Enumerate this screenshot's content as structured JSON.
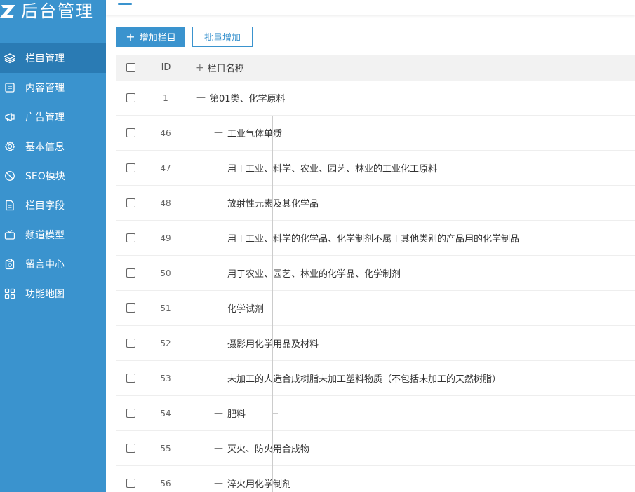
{
  "logo": {
    "text": "后台管理"
  },
  "nav": [
    {
      "label": "栏目管理",
      "icon": "layers-icon",
      "active": true
    },
    {
      "label": "内容管理",
      "icon": "document-icon",
      "active": false
    },
    {
      "label": "广告管理",
      "icon": "ad-icon",
      "active": false
    },
    {
      "label": "基本信息",
      "icon": "gear-icon",
      "active": false
    },
    {
      "label": "SEO模块",
      "icon": "seo-icon",
      "active": false
    },
    {
      "label": "栏目字段",
      "icon": "file-icon",
      "active": false
    },
    {
      "label": "频道模型",
      "icon": "tv-icon",
      "active": false
    },
    {
      "label": "留言中心",
      "icon": "message-icon",
      "active": false
    },
    {
      "label": "功能地图",
      "icon": "grid-icon",
      "active": false
    }
  ],
  "toolbar": {
    "add_label": "增加栏目",
    "add_icon": "plus-icon",
    "batch_label": "批量增加"
  },
  "table": {
    "headers": {
      "id": "ID",
      "name": "栏目名称",
      "name_prefix": "+"
    },
    "root": {
      "id": "1",
      "name": "第01类、化学原料"
    },
    "children": [
      {
        "id": "46",
        "name": "工业气体单质"
      },
      {
        "id": "47",
        "name": "用于工业、科学、农业、园艺、林业的工业化工原料"
      },
      {
        "id": "48",
        "name": "放射性元素及其化学品"
      },
      {
        "id": "49",
        "name": "用于工业、科学的化学品、化学制剂不属于其他类别的产品用的化学制品"
      },
      {
        "id": "50",
        "name": "用于农业、园艺、林业的化学品、化学制剂"
      },
      {
        "id": "51",
        "name": "化学试剂"
      },
      {
        "id": "52",
        "name": "摄影用化学用品及材料"
      },
      {
        "id": "53",
        "name": "未加工的人造合成树脂未加工塑料物质（不包括未加工的天然树脂）"
      },
      {
        "id": "54",
        "name": "肥料"
      },
      {
        "id": "55",
        "name": "灭火、防火用合成物"
      },
      {
        "id": "56",
        "name": "淬火用化学制剂"
      }
    ]
  },
  "tree": {
    "dash": "—"
  }
}
